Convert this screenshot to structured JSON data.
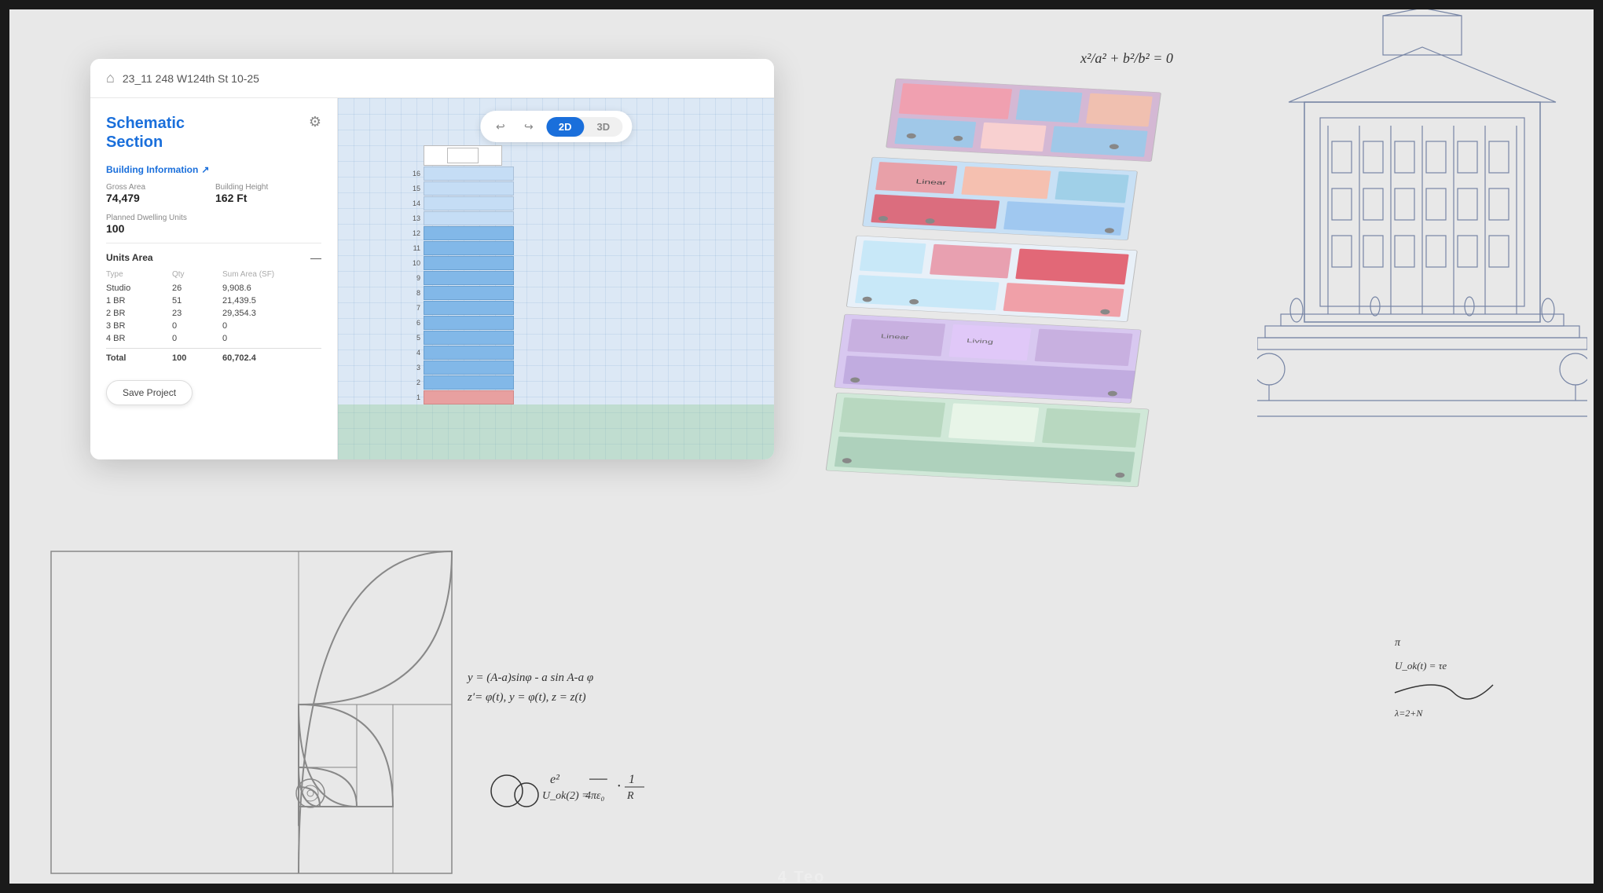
{
  "window": {
    "title": "23_11 248 W124th St 10-25",
    "home_icon": "🏠"
  },
  "sidebar": {
    "section_title_line1": "Schematic",
    "section_title_line2": "Section",
    "gear_icon": "⚙",
    "building_info_label": "Building Information",
    "building_info_arrow": "↗",
    "gross_area_label": "Gross Area",
    "gross_area_value": "74,479",
    "building_height_label": "Building Height",
    "building_height_value": "162 Ft",
    "planned_units_label": "Planned Dwelling Units",
    "planned_units_value": "100",
    "units_area_label": "Units Area",
    "units_toggle": "—",
    "table_headers": [
      "Type",
      "Qty",
      "Sum Area (SF)"
    ],
    "table_rows": [
      {
        "type": "Studio",
        "qty": "26",
        "sum": "9,908.6"
      },
      {
        "type": "1 BR",
        "qty": "51",
        "sum": "21,439.5"
      },
      {
        "type": "2 BR",
        "qty": "23",
        "sum": "29,354.3"
      },
      {
        "type": "3 BR",
        "qty": "0",
        "sum": "0"
      },
      {
        "type": "4 BR",
        "qty": "0",
        "sum": "0"
      }
    ],
    "total_label": "Total",
    "total_qty": "100",
    "total_sum": "60,702.4",
    "save_button": "Save Project"
  },
  "canvas": {
    "undo_icon": "↩",
    "redo_icon": "↪",
    "view_2d": "2D",
    "view_3d": "3D",
    "active_view": "2D"
  },
  "building": {
    "floors": [
      "16",
      "15",
      "14",
      "13",
      "12",
      "11",
      "10",
      "9",
      "8",
      "7",
      "6",
      "5",
      "4",
      "3",
      "2",
      "1"
    ]
  },
  "math": {
    "eq1": "x²/a² + b²/b² = 0",
    "eq2": "y = (A-a)sin φ - a sin((A-a)/a)φ",
    "eq3": "z'= φ(t), y = φ(t), z = z(t)",
    "eq4": "U_ok(2) = e²/4πε₀ · 1/R"
  },
  "bottom": {
    "label": "4 Teo"
  }
}
